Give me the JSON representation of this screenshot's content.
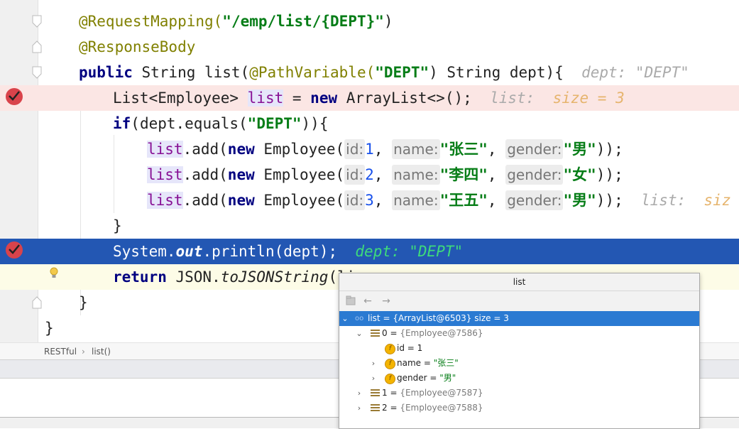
{
  "editor": {
    "lines": [
      {
        "annotation": "@RequestMapping(",
        "string": "\"/emp/list/{DEPT}\"",
        "close": ")"
      },
      {
        "annotation": "@ResponseBody"
      },
      {
        "kw": "public",
        "text_a": " String list(",
        "annotation": "@PathVariable(",
        "string": "\"DEPT\"",
        "text_b": ") String dept){",
        "hint": "dept: \"DEPT\""
      },
      {
        "text_a": "List<Employee> ",
        "var": "list",
        "text_b": " = ",
        "kw": "new",
        "text_c": " ArrayList<>();",
        "hint_label": "list:",
        "hint_value": "size = 3"
      },
      {
        "kw": "if",
        "text_a": "(dept.equals(",
        "string": "\"DEPT\"",
        "text_b": ")){"
      },
      {
        "var": "list",
        "text_a": ".add(",
        "kw": "new",
        "text_b": " Employee(",
        "p1": "id:",
        "v1": "1",
        "p2": "name:",
        "v2": "\"张三\"",
        "p3": "gender:",
        "v3": "\"男\"",
        "close": "));"
      },
      {
        "var": "list",
        "text_a": ".add(",
        "kw": "new",
        "text_b": " Employee(",
        "p1": "id:",
        "v1": "2",
        "p2": "name:",
        "v2": "\"李四\"",
        "p3": "gender:",
        "v3": "\"女\"",
        "close": "));"
      },
      {
        "var": "list",
        "text_a": ".add(",
        "kw": "new",
        "text_b": " Employee(",
        "p1": "id:",
        "v1": "3",
        "p2": "name:",
        "v2": "\"王五\"",
        "p3": "gender:",
        "v3": "\"男\"",
        "close": "));",
        "hint_label": "list:",
        "hint_value": "siz"
      },
      {
        "text": "}"
      },
      {
        "text_a": "System.",
        "italic": "out",
        "text_b": ".println(dept);",
        "hint": "dept: \"DEPT\""
      },
      {
        "kw": "return",
        "text_a": " JSON.",
        "italic": "toJSONString",
        "text_b": "(li"
      },
      {
        "text": "}"
      },
      {
        "text": "}"
      }
    ]
  },
  "breadcrumb": {
    "items": [
      "RESTful",
      "list()"
    ],
    "separator": "›"
  },
  "popup": {
    "title": "list",
    "rows": [
      {
        "arrow": "⌄",
        "prefix": "oo",
        "name": "list",
        "eq": " = ",
        "value": "{ArrayList@6503}",
        "extra": "  size = 3"
      },
      {
        "arrow": "⌄",
        "name": "0",
        "eq": " = ",
        "value": "{Employee@7586}"
      },
      {
        "arrow": "",
        "name": "id",
        "eq": " = ",
        "value": "1"
      },
      {
        "arrow": "›",
        "name": "name",
        "eq": " = ",
        "value": "\"张三\""
      },
      {
        "arrow": "›",
        "name": "gender",
        "eq": " = ",
        "value": "\"男\""
      },
      {
        "arrow": "›",
        "name": "1",
        "eq": " = ",
        "value": "{Employee@7587}"
      },
      {
        "arrow": "›",
        "name": "2",
        "eq": " = ",
        "value": "{Employee@7588}"
      }
    ],
    "field_icon": "f"
  },
  "colors": {
    "breakpoint": "#d9434b",
    "selection": "#2357b3",
    "popup_selection": "#2a7ad2"
  }
}
